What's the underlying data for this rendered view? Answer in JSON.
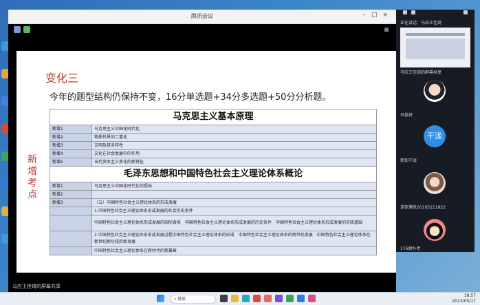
{
  "meeting": {
    "window_title": "腾讯会议"
  },
  "slide": {
    "title": "变化三",
    "subtitle": "今年的题型结构仍保持不变，16分单选题+34分多选题+50分分析题。",
    "side_label": "新增考点",
    "tables": [
      {
        "heading": "马克思主义基本原理",
        "rows": [
          {
            "key": "新增1",
            "value": "马克思主义中国化时代化"
          },
          {
            "key": "新增2",
            "value": "物质世界的二重化"
          },
          {
            "key": "新增3",
            "value": "文明及其多样性"
          },
          {
            "key": "新增4",
            "value": "文化在社会发展中的作用"
          },
          {
            "key": "新增5",
            "value": "当代资本主义变化的新特征"
          }
        ]
      },
      {
        "heading": "毛泽东思想和中国特色社会主义理论体系概论",
        "rows": [
          {
            "key": "新增1",
            "value": "马克思主义中国化时代化的提出"
          },
          {
            "key": "新增2",
            "value": ""
          },
          {
            "key": "新增3",
            "value": "（五）中国特色社会主义理论体系的形成发展"
          },
          {
            "key": "",
            "value": "1.中国特色社会主义理论体系形成发展的社会历史条件"
          },
          {
            "key": "",
            "value": "中国特色社会主义理论体系形成发展的国际背景　中国特色社会主义理论体系形成发展的历史条件　中国特色社会主义理论体系形成发展的实践基础"
          },
          {
            "key": "",
            "value": "2.中国特色社会主义理论体系形成发展过程中国特色社会主义理论体系的形成　中国特色社会主义理论体系的跨世纪发展　中国特色社会主义理论体系在新世纪新阶段的新发展"
          },
          {
            "key": "",
            "value": "中国特色社会主义理论体系在新时代的新篇章"
          }
        ]
      }
    ]
  },
  "status_bar": {
    "text": "马应王佳琦的屏幕共享"
  },
  "panel": {
    "share_label": "正在讲话：马应王佳琦",
    "participants": [
      {
        "name": "马应王佳琦的屏幕共享"
      },
      {
        "name": "马俊妍"
      },
      {
        "name": "熙如干泷",
        "avatar_text": "干泷"
      },
      {
        "name": "诺依博凯20195111822"
      },
      {
        "name": "176顾扑老"
      }
    ]
  },
  "taskbar": {
    "search_label": "搜索",
    "time": "18:57",
    "date": "2023/05/17"
  },
  "colors": {
    "accent_red": "#c0392b",
    "table_key_bg": "#c8d3e8",
    "table_value_bg": "#dfe6f3",
    "avatar_blue": "#2f8fe6"
  }
}
